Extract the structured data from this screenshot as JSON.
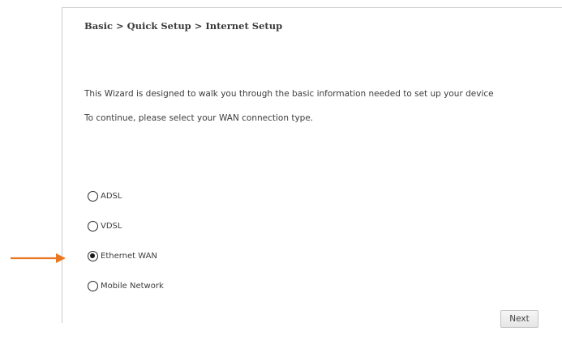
{
  "breadcrumb": "Basic > Quick Setup > Internet Setup",
  "intro": {
    "line1": "This Wizard is designed to walk you through the basic information needed to set up your device",
    "line2": "To continue, please select your WAN connection type."
  },
  "wan_types": {
    "options": [
      {
        "label": "ADSL",
        "selected": false
      },
      {
        "label": "VDSL",
        "selected": false
      },
      {
        "label": "Ethernet WAN",
        "selected": true
      },
      {
        "label": "Mobile Network",
        "selected": false
      }
    ]
  },
  "buttons": {
    "next_label": "Next"
  },
  "annotation": {
    "arrow_color": "#e87722",
    "arrow_icon": "arrow-right-icon"
  }
}
